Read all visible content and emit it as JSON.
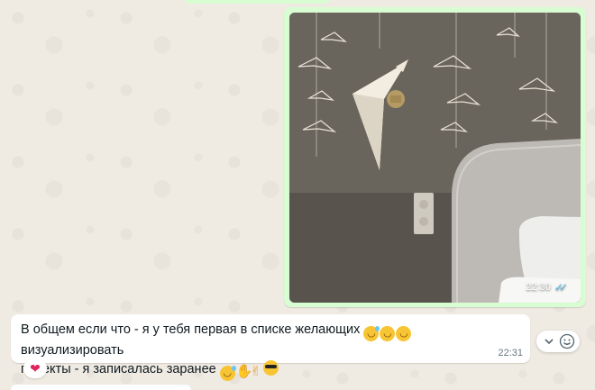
{
  "image_message": {
    "time": "22:30",
    "status_icon": "double-check-read-icon",
    "colors": {
      "bubble": "#d9fdd3",
      "check": "#53bdeb"
    }
  },
  "text_message": {
    "line1": "В общем если что - я у тебя первая в списке желающих",
    "line1_end": "визуализировать",
    "line2": "проекты - я записалась заранее",
    "emojis_line1": [
      "grinning-squinting-sweat",
      "grinning-squinting",
      "grinning-squinting"
    ],
    "emojis_line2": [
      "tears-of-joy",
      "ok-hand",
      "crossed-fingers",
      "sunglasses"
    ],
    "time": "22:31"
  },
  "reaction": {
    "icon": "heart-icon",
    "color": "#e0245e"
  },
  "message_actions": {
    "menu_icon": "chevron-down-icon",
    "react_icon": "smiley-icon"
  },
  "colors": {
    "chat_background": "#efeae2",
    "incoming_bubble": "#ffffff",
    "text": "#111b21",
    "meta": "#667781"
  }
}
